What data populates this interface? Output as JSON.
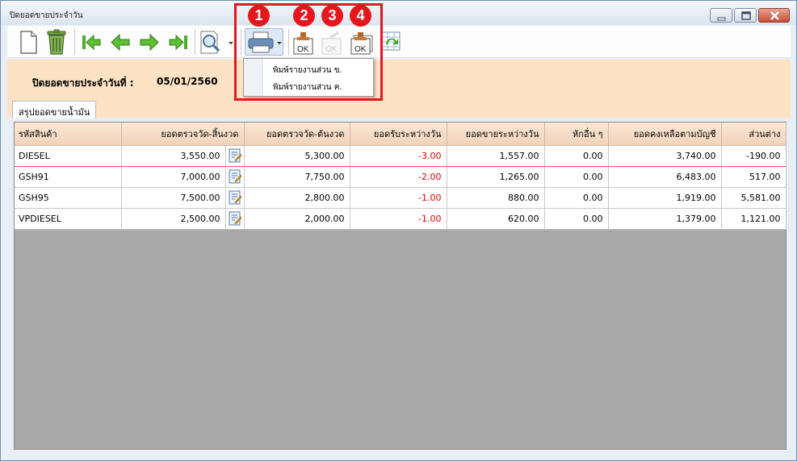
{
  "window": {
    "title": "ปิดยอดขายประจำวัน"
  },
  "toolbar": {
    "buttons": [
      {
        "name": "new-document",
        "icon": "document-icon"
      },
      {
        "name": "delete",
        "icon": "trash-icon"
      },
      {
        "name": "first-record",
        "icon": "first-icon"
      },
      {
        "name": "previous-record",
        "icon": "arrow-left-icon"
      },
      {
        "name": "next-record",
        "icon": "arrow-right-icon"
      },
      {
        "name": "last-record",
        "icon": "last-icon"
      },
      {
        "name": "search",
        "icon": "magnifier-icon"
      },
      {
        "name": "print",
        "icon": "printer-icon"
      },
      {
        "name": "confirm-ok",
        "icon": "ok-stamp-icon"
      },
      {
        "name": "confirm-ok-disabled",
        "icon": "ok-stamp-disabled-icon"
      },
      {
        "name": "confirm-ok-multiple",
        "icon": "ok-stamp-stack-icon"
      },
      {
        "name": "refresh-sheet",
        "icon": "refresh-sheet-icon"
      }
    ]
  },
  "print_menu": {
    "items": [
      "พิมพ์รายงานส่วน ข.",
      "พิมพ์รายงานส่วน ค."
    ]
  },
  "callouts": [
    "1",
    "2",
    "3",
    "4"
  ],
  "header": {
    "close_label": "ปิดยอดขายประจำวันที่ :",
    "close_date": "05/01/2560"
  },
  "tabs": [
    {
      "label": "สรุปยอดขายน้ำมัน",
      "active": true
    }
  ],
  "table": {
    "columns": [
      "รหัสสินค้า",
      "ยอดตรวจวัด-สิ้นงวด",
      "ยอดตรวจวัด-ต้นงวด",
      "ยอดรับระหว่างวัน",
      "ยอดขายระหว่างวัน",
      "หักอื่น ๆ",
      "ยอดคงเหลือตามบัญชี",
      "ส่วนต่าง"
    ],
    "rows": [
      {
        "code": "DIESEL",
        "end": "3,550.00",
        "start": "5,300.00",
        "received": "-3.00",
        "sold": "1,557.00",
        "deduct": "0.00",
        "balance": "3,740.00",
        "diff": "-190.00"
      },
      {
        "code": "GSH91",
        "end": "7,000.00",
        "start": "7,750.00",
        "received": "-2.00",
        "sold": "1,265.00",
        "deduct": "0.00",
        "balance": "6,483.00",
        "diff": "517.00"
      },
      {
        "code": "GSH95",
        "end": "7,500.00",
        "start": "2,800.00",
        "received": "-1.00",
        "sold": "880.00",
        "deduct": "0.00",
        "balance": "1,919.00",
        "diff": "5,581.00"
      },
      {
        "code": "VPDIESEL",
        "end": "2,500.00",
        "start": "2,000.00",
        "received": "-1.00",
        "sold": "620.00",
        "deduct": "0.00",
        "balance": "1,379.00",
        "diff": "1,121.00"
      }
    ]
  },
  "colors": {
    "header_panel": "#fde3c4",
    "negative_text": "#e00000",
    "callout_red": "#e5161c",
    "grid_empty": "#a8a8a8"
  }
}
